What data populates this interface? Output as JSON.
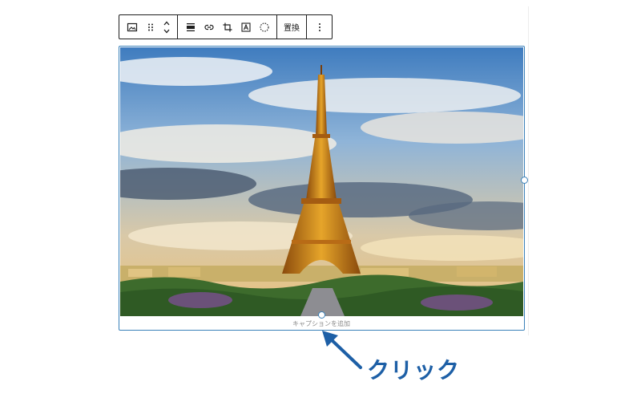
{
  "toolbar": {
    "buttons": [
      {
        "icon": "image-block-icon"
      },
      {
        "icon": "drag-handle-icon"
      },
      {
        "icon": "move-up-icon"
      },
      {
        "icon": "move-down-icon"
      },
      {
        "icon": "align-icon"
      },
      {
        "icon": "link-icon"
      },
      {
        "icon": "crop-icon"
      },
      {
        "icon": "text-overlay-icon"
      },
      {
        "icon": "select-motif-icon"
      },
      {
        "icon": "more-options-icon"
      }
    ],
    "replace_label": "置換"
  },
  "image_block": {
    "caption_placeholder": "キャプションを追加",
    "selected": true
  },
  "annotation": {
    "label": "クリック",
    "color": "#1d5fa6"
  },
  "colors": {
    "selection_border": "#3a81b9",
    "toolbar_border": "#1e1e1e"
  }
}
